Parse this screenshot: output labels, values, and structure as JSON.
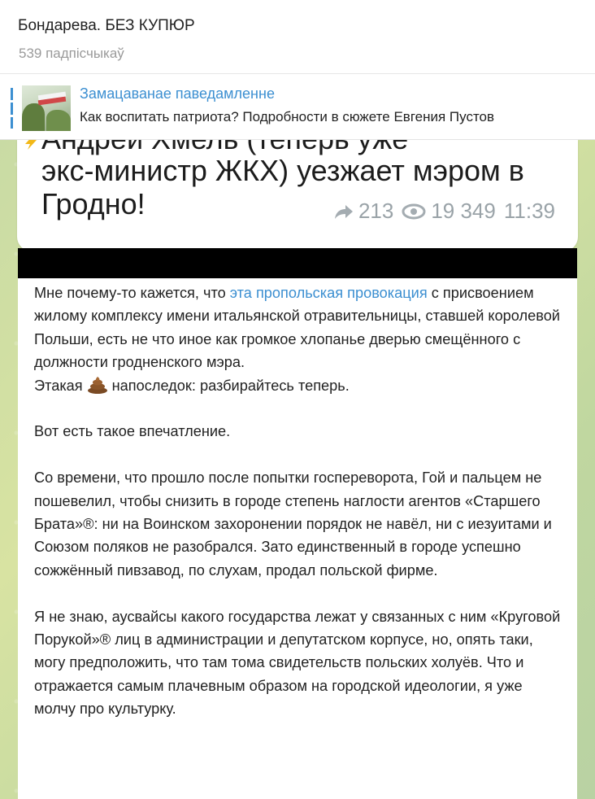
{
  "header": {
    "channel_title": "Бондарева. БЕЗ КУПЮР",
    "subscribers": "539 падпісчыкаў"
  },
  "pinned": {
    "label": "Замацаванае паведамленне",
    "text": "Как воспитать патриота? Подробности в сюжете Евгения Пустов"
  },
  "photo_post": {
    "line0": "Андрей Хмель (теперь уже",
    "line1": "экс-министр ЖКХ) уезжает мэром в",
    "line2": "Гродно!",
    "forwards": "213",
    "views": "19 349",
    "time": "11:39"
  },
  "post": {
    "p1_a": "Мне почему-то кажется, что ",
    "p1_link": "эта пропольская провокация",
    "p1_b": " с присвоением жилому комплексу имени итальянской отравительницы, ставшей королевой Польши, есть не что иное как громкое хлопанье дверью смещённого с должности гродненского мэра.",
    "p2_a": "Этакая",
    "p2_b": "напоследок: разбирайтесь теперь.",
    "p3": "Вот есть такое впечатление.",
    "p4": "Со времени, что прошло после попытки госпереворота, Гой и пальцем не пошевелил, чтобы снизить в городе степень наглости агентов «Старшего Брата»®: ни на Воинском захоронении порядок не навёл, ни с иезуитами и Союзом поляков не разобрался. Зато единственный в городе успешно сожжённый пивзавод, по слухам, продал польской фирме.",
    "p5": "Я не знаю, аусвайсы какого государства лежат у связанных с ним «Круговой Порукой»® лиц в администрации и депутатском корпусе, но, опять таки, могу предположить, что там тома свидетельств польских холуёв. Что и отражается самым плачевным образом на городской идеологии, я уже молчу про культурку."
  },
  "icons": {
    "forward": "forward-arrow-icon",
    "views": "eye-icon",
    "emoji": "pile-of-poo-emoji"
  },
  "colors": {
    "link": "#3c8fd1",
    "accent": "#3c8fd1",
    "chat_background": "#c9dba4"
  }
}
